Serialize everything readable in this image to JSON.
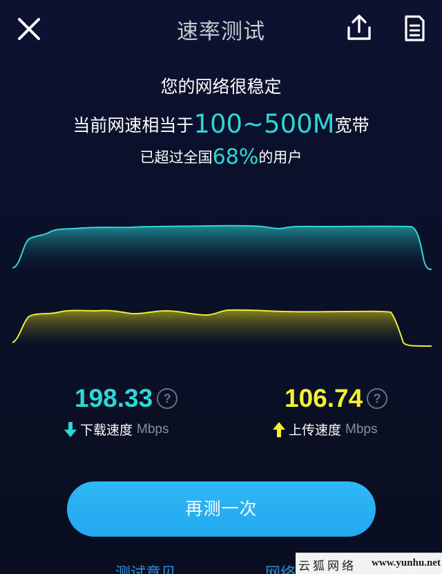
{
  "header": {
    "title": "速率测试"
  },
  "summary": {
    "stability": "您的网络很稳定",
    "bandwidth_prefix": "当前网速相当于",
    "bandwidth_value": "100~500M",
    "bandwidth_suffix": "宽带",
    "rank_prefix": "已超过全国",
    "rank_value": "68%",
    "rank_suffix": "的用户"
  },
  "results": {
    "download": {
      "value": "198.33",
      "label": "下载速度",
      "unit": "Mbps"
    },
    "upload": {
      "value": "106.74",
      "label": "上传速度",
      "unit": "Mbps"
    },
    "help_glyph": "?"
  },
  "actions": {
    "retest_label": "再测一次",
    "feedback_label": "测试意见",
    "diagnose_label": "网络诊断"
  },
  "watermark": {
    "cn": "云狐网络",
    "en": "www.yunhu.net"
  },
  "colors": {
    "download_accent": "#2ed6d6",
    "upload_accent": "#f2f233",
    "button": "#25aaf0",
    "link": "#2c8fd6"
  },
  "icons": {
    "close": "close-icon",
    "share": "share-icon",
    "report": "document-icon",
    "download_arrow": "arrow-down-icon",
    "upload_arrow": "arrow-up-icon"
  }
}
